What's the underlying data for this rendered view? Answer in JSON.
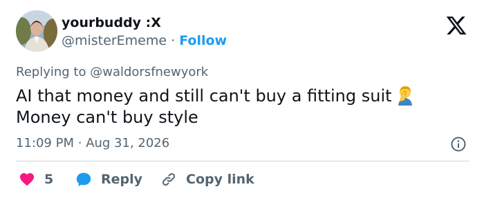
{
  "author": {
    "display_name": "yourbuddy :X",
    "handle": "@misterEmeme",
    "separator": "·",
    "follow_label": "Follow"
  },
  "reply_context": {
    "prefix": "Replying to",
    "mention": "@waldorsfnewyork"
  },
  "tweet": {
    "line1": "AI that money and still can't buy a fitting suit",
    "line2": "Money can't buy style",
    "emoji": "man-facepalming-emoji"
  },
  "meta": {
    "time": "11:09 PM",
    "separator": "·",
    "date": "Aug 31, 2026"
  },
  "actions": {
    "like_count": "5",
    "reply_label": "Reply",
    "copy_label": "Copy link"
  },
  "icons": {
    "brand": "x-logo-icon",
    "like": "heart-icon",
    "reply": "speech-bubble-icon",
    "copy": "link-icon",
    "info": "info-icon"
  },
  "colors": {
    "text": "#0f1419",
    "secondary": "#536471",
    "accent": "#1d9bf0",
    "like": "#f91880",
    "divider": "#cfd9de"
  }
}
